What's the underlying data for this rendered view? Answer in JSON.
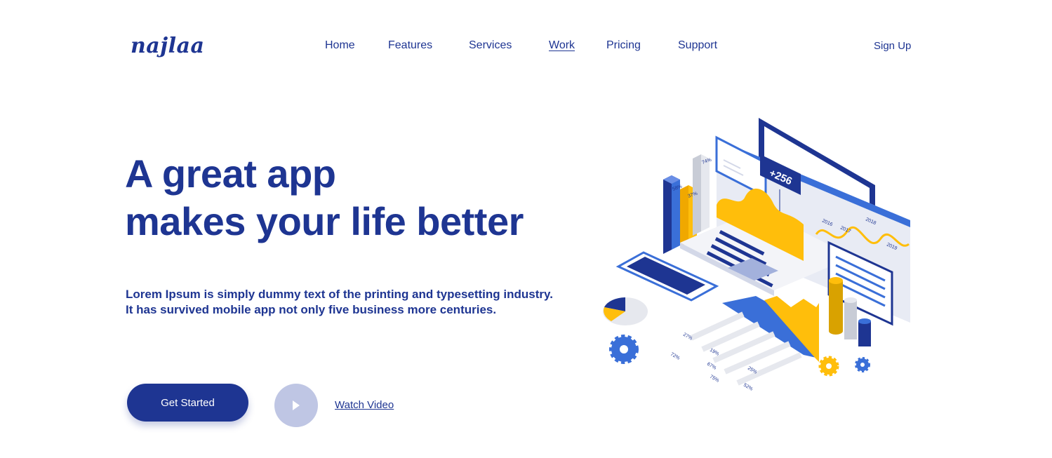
{
  "brand": {
    "logo_text": "najlaa"
  },
  "nav": {
    "items": [
      {
        "label": "Home"
      },
      {
        "label": "Features"
      },
      {
        "label": "Services"
      },
      {
        "label": "Work"
      },
      {
        "label": "Pricing"
      },
      {
        "label": "Support"
      }
    ],
    "active": "Work",
    "signup_label": "Sign Up"
  },
  "hero": {
    "title_line1": "A great app",
    "title_line2": "makes your life better",
    "sub_line1": "Lorem Ipsum is simply dummy text of the printing and typesetting industry.",
    "sub_line2": "It has survived mobile app not only five business more centuries.",
    "cta_label": "Get Started",
    "video_label": "Watch Video"
  },
  "illustration": {
    "badge_text": "+256",
    "bar_labels": [
      "58%",
      "37%",
      "74%"
    ],
    "year_labels": [
      "2016",
      "2017",
      "2018",
      "2019"
    ],
    "stat_labels": [
      "27%",
      "19%",
      "72%",
      "67%",
      "25%",
      "75%",
      "52%"
    ]
  },
  "colors": {
    "primary": "#1e3592",
    "accent": "#ffbe0b",
    "mid_blue": "#3a6fd8",
    "play_bg": "#bfc6e4"
  }
}
